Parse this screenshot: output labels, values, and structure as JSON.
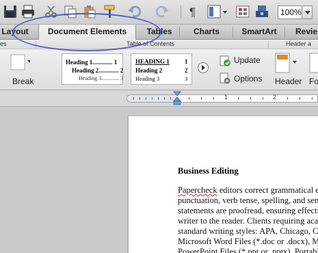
{
  "toolbar": {
    "zoom": "100%",
    "icons": [
      "save-icon",
      "print-icon",
      "cut-icon",
      "copy-icon",
      "paste-icon",
      "format-painter-icon",
      "undo-icon",
      "redo-icon",
      "show-paragraph-icon",
      "view-layout-icon",
      "gallery-icon",
      "toolbox-icon"
    ]
  },
  "tabs": {
    "layout": "Layout",
    "document_elements": "Document Elements",
    "tables": "Tables",
    "charts": "Charts",
    "smartart": "SmartArt",
    "review": "Revie"
  },
  "ribbon": {
    "group_left_fragment": "es",
    "group_toc": "Table of Contents",
    "group_header": "Header a",
    "break_label": "Break",
    "update_label": "Update",
    "options_label": "Options",
    "header_label": "Header",
    "footer_label": "Fo",
    "toc_classic": {
      "h1": "Heading 1............. 1",
      "h2": "Heading 2............. 2",
      "h3": "Heading 3............. 3"
    },
    "toc_modern": {
      "h1": "HEADING 1",
      "h1n": "1",
      "h2": "Heading 2",
      "h2n": "2",
      "h3": "Heading 3",
      "h3n": "3"
    }
  },
  "ruler": {
    "n1": "1",
    "n2": "2"
  },
  "document": {
    "heading": "Business Editing",
    "lines": [
      "Papercheck editors correct grammatical err",
      "punctuation, verb tense, spelling, and sente",
      "statements are proofread, ensuring effectiv",
      "writer to the reader. Clients requiring acad",
      "standard writing styles: APA, Chicago, CS",
      "Microsoft Word Files (*.doc or .docx), Mic",
      "PowerPoint Files (*.ppt or .pptx), Portable"
    ]
  },
  "colors": {
    "annotation": "#4a5fd4",
    "spellcheck": "#d22222"
  }
}
